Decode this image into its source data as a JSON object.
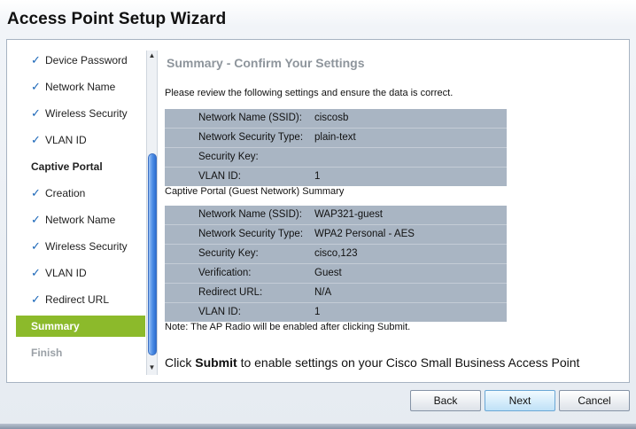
{
  "window": {
    "title": "Access Point Setup Wizard"
  },
  "sidebar": {
    "items": [
      {
        "label": "Device Password",
        "checked": true
      },
      {
        "label": "Network Name",
        "checked": true
      },
      {
        "label": "Wireless Security",
        "checked": true
      },
      {
        "label": "VLAN ID",
        "checked": true
      },
      {
        "label": "Captive Portal",
        "section": true
      },
      {
        "label": "Creation",
        "checked": true
      },
      {
        "label": "Network Name",
        "checked": true
      },
      {
        "label": "Wireless Security",
        "checked": true
      },
      {
        "label": "VLAN ID",
        "checked": true
      },
      {
        "label": "Redirect URL",
        "checked": true
      },
      {
        "label": "Summary",
        "active": true
      },
      {
        "label": "Finish",
        "disabled": true
      }
    ],
    "check_glyph": "✓"
  },
  "scrollbar": {
    "up_glyph": "▲",
    "down_glyph": "▼"
  },
  "main": {
    "heading": "Summary - Confirm Your Settings",
    "intro": "Please review the following settings and ensure the data is correct.",
    "network": [
      {
        "key": "Network Name (SSID):",
        "value": "ciscosb"
      },
      {
        "key": "Network Security Type:",
        "value": "plain-text"
      },
      {
        "key": "Security Key:",
        "value": ""
      },
      {
        "key": "VLAN ID:",
        "value": "1"
      }
    ],
    "captive_heading": "Captive Portal (Guest Network) Summary",
    "captive": [
      {
        "key": "Network Name (SSID):",
        "value": "WAP321-guest"
      },
      {
        "key": "Network Security Type:",
        "value": "WPA2 Personal - AES"
      },
      {
        "key": "Security Key:",
        "value": "cisco,123"
      },
      {
        "key": "Verification:",
        "value": "Guest"
      },
      {
        "key": "Redirect URL:",
        "value": "N/A"
      },
      {
        "key": "VLAN ID:",
        "value": "1"
      }
    ],
    "note": "Note: The AP Radio will be enabled after clicking Submit.",
    "submit_prefix": "Click ",
    "submit_word": "Submit",
    "submit_suffix": " to enable settings on your Cisco Small Business Access Point"
  },
  "buttons": {
    "back": "Back",
    "next": "Next",
    "cancel": "Cancel"
  },
  "colors": {
    "active_item": "#8cba2b",
    "check": "#1a66b8",
    "table_bg": "#a9b5c3",
    "heading": "#8e959c"
  }
}
